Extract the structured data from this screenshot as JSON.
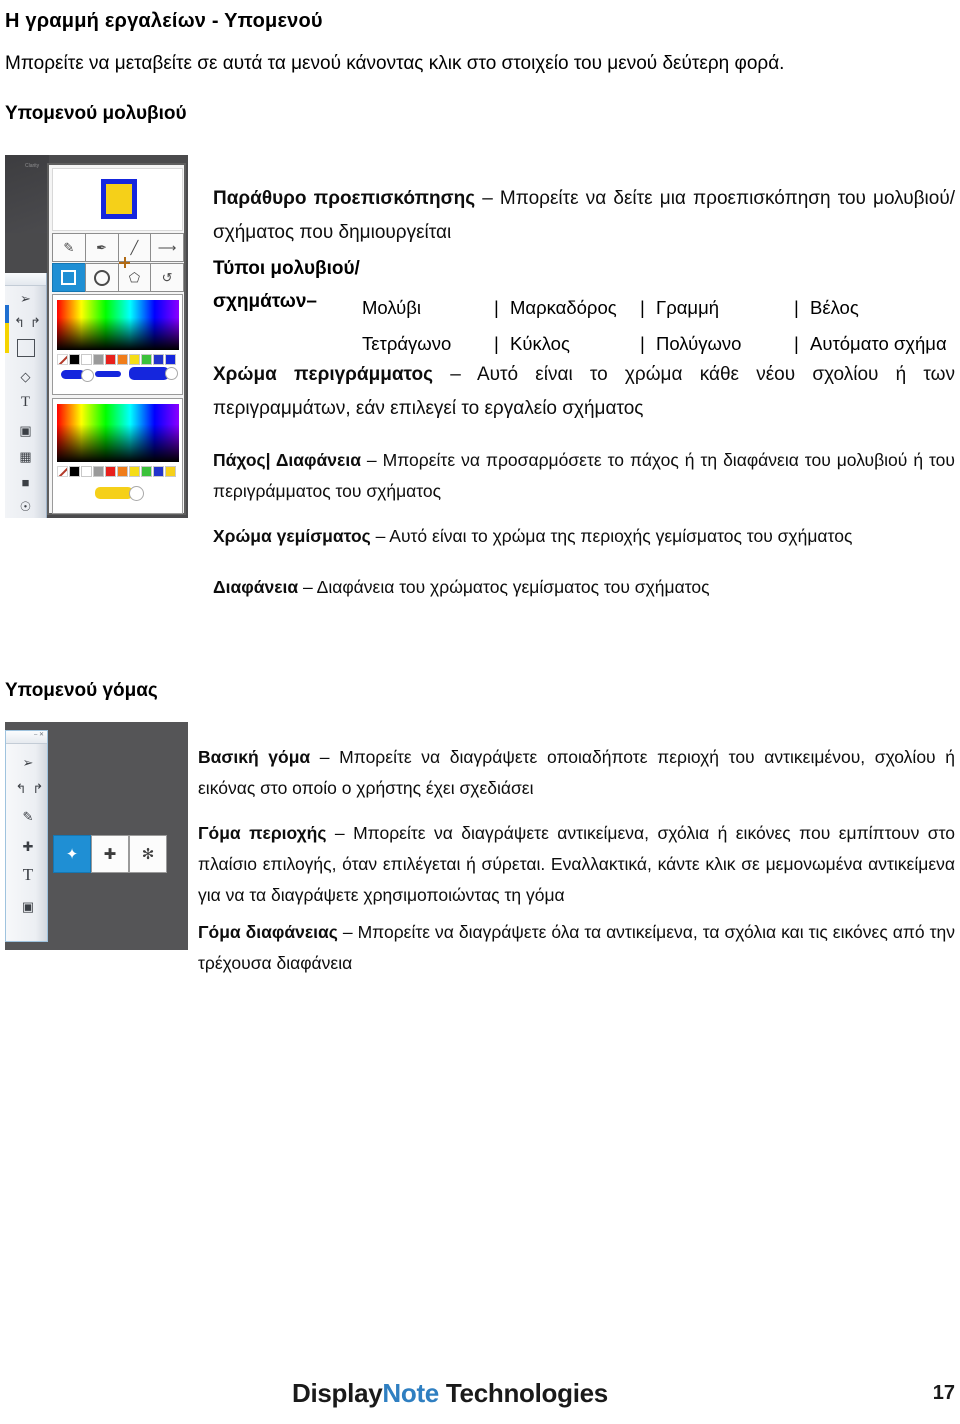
{
  "document": {
    "title": "Η γραμμή εργαλείων - Υπομενού",
    "intro": "Μπορείτε να μεταβείτε σε αυτά τα μενού κάνοντας κλικ στο στοιχείο του μενού δεύτερη φορά."
  },
  "sections": [
    {
      "heading": "Υπομενού μολυβιού",
      "entries": [
        {
          "term": "Παράθυρο προεπισκόπησης",
          "dash": " – ",
          "description": "Μπορείτε να δείτε μια προεπισκόπηση του μολυβιού/σχήματος που δημιουργείται"
        },
        {
          "term": "Χρώμα περιγράμματος",
          "dash": " – ",
          "description": "Αυτό είναι το χρώμα κάθε νέου σχολίου ή των περιγραμμάτων, εάν επιλεγεί το εργαλείο σχήματος"
        },
        {
          "term": "Πάχος| Διαφάνεια",
          "dash": " – ",
          "description": "Μπορείτε να προσαρμόσετε το πάχος ή τη διαφάνεια του μολυβιού ή του περιγράμματος του σχήματος"
        },
        {
          "term": "Χρώμα γεμίσματος",
          "dash": " – ",
          "description": "Αυτό είναι το χρώμα της περιοχής γεμίσματος του σχήματος"
        },
        {
          "term": "Διαφάνεια",
          "dash": " – ",
          "description": "Διαφάνεια του χρώματος γεμίσματος του σχήματος"
        }
      ],
      "types_table": {
        "label_line1": "Τύποι μολυβιού/",
        "label_line2": "σχημάτων–",
        "separator": "|",
        "rows": [
          [
            "Μολύβι",
            "Μαρκαδόρος",
            "Γραμμή",
            "Βέλος"
          ],
          [
            "Τετράγωνο",
            "Κύκλος",
            "Πολύγωνο",
            "Αυτόματο σχήμα"
          ]
        ]
      }
    },
    {
      "heading": "Υπομενού γόμας",
      "entries": [
        {
          "term": "Βασική γόμα",
          "dash": " – ",
          "description": "Μπορείτε να διαγράψετε οποιαδήποτε περιοχή του αντικειμένου, σχολίου ή εικόνας στο οποίο ο χρήστης έχει σχεδιάσει"
        },
        {
          "term": "Γόμα περιοχής",
          "dash": " – ",
          "description": "Μπορείτε να διαγράψετε αντικείμενα, σχόλια ή εικόνες που εμπίπτουν στο πλαίσιο επιλογής, όταν επιλέγεται ή σύρεται. Εναλλακτικά, κάντε κλικ σε μεμονωμένα αντικείμενα για να τα διαγράψετε χρησιμοποιώντας τη γόμα"
        },
        {
          "term": "Γόμα διαφάνειας",
          "dash": " – ",
          "description": "Μπορείτε να διαγράψετε όλα τα αντικείμενα, τα σχόλια και τις εικόνες από την τρέχουσα διαφάνεια"
        }
      ]
    }
  ],
  "pencil_screenshot": {
    "name": "pencil-submenu-screenshot",
    "preview_fill_color": "#f5d019",
    "preview_outline_color": "#1526dd",
    "pen_tools": [
      "pencil-icon",
      "marker-icon",
      "line-icon",
      "arrow-icon"
    ],
    "shape_tools": [
      "square-icon",
      "circle-icon",
      "polygon-icon",
      "auto-shape-icon"
    ],
    "selected_shape_tool": "square-icon",
    "selected_tool_highlight": "#1f8fd4",
    "outline_swatches": [
      "diagonal",
      "#000000",
      "#ffffff",
      "#9a9a9a",
      "#e8201c",
      "#f07d1b",
      "#f5dd17",
      "#3cc13b",
      "#2233cc",
      "#1526dd"
    ],
    "fill_swatches": [
      "diagonal",
      "#000000",
      "#ffffff",
      "#9a9a9a",
      "#e8201c",
      "#f07d1b",
      "#f5dd17",
      "#3cc13b",
      "#2233cc",
      "#f5d019"
    ],
    "outline_slider_color": "#1526dd",
    "fill_slider_color": "#f5d019",
    "toolbar_icons": [
      "cursor-icon",
      "undo-icon",
      "redo-icon",
      "square-icon",
      "eraser-icon",
      "text-icon",
      "stamp-icon",
      "grid-icon",
      "note-icon",
      "settings-icon"
    ]
  },
  "eraser_screenshot": {
    "name": "eraser-submenu-screenshot",
    "eraser_tools": [
      "basic-eraser-icon",
      "area-eraser-icon",
      "slide-eraser-icon"
    ],
    "selected_eraser_tool": "basic-eraser-icon",
    "selected_tool_highlight": "#1f8fd4",
    "toolbar_icons": [
      "cursor-icon",
      "undo-icon",
      "redo-icon",
      "pen-icon",
      "eraser-icon",
      "text-icon",
      "stamp-icon"
    ]
  },
  "footer": {
    "logo_part1": "Display",
    "logo_part2": "Note",
    "logo_part3": " Technologies",
    "note_color": "#2f7fc1",
    "page_number": "17"
  }
}
